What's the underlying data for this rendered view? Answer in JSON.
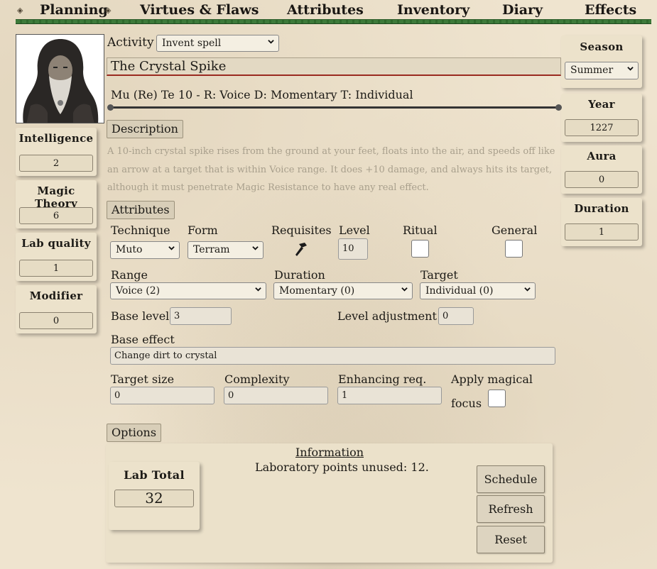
{
  "nav": {
    "items": [
      "Planning",
      "Virtues & Flaws",
      "Attributes",
      "Inventory",
      "Diary",
      "Effects"
    ]
  },
  "left_stats": [
    {
      "title": "Intelligence",
      "value": "2"
    },
    {
      "title": "Magic Theory",
      "value": "6"
    },
    {
      "title": "Lab quality",
      "value": "1"
    },
    {
      "title": "Modifier",
      "value": "0"
    }
  ],
  "right_stats": {
    "season": {
      "title": "Season",
      "value": "Summer"
    },
    "year": {
      "title": "Year",
      "value": "1227"
    },
    "aura": {
      "title": "Aura",
      "value": "0"
    },
    "duration": {
      "title": "Duration",
      "value": "1"
    }
  },
  "activity": {
    "label": "Activity",
    "value": "Invent spell"
  },
  "spell": {
    "name": "The Crystal Spike",
    "summary": "Mu (Re) Te 10 - R: Voice D: Momentary T: Individual"
  },
  "description": {
    "button": "Description",
    "text": "A 10-inch crystal spike rises from the ground at your feet, floats into the air, and speeds off like an arrow at a target that is within Voice range. It does +10 damage, and always hits its target, although it must penetrate Magic Resistance to have any real effect."
  },
  "attributes": {
    "button": "Attributes",
    "technique": {
      "label": "Technique",
      "value": "Muto"
    },
    "form": {
      "label": "Form",
      "value": "Terram"
    },
    "requisites": {
      "label": "Requisites"
    },
    "level": {
      "label": "Level",
      "value": "10"
    },
    "ritual": {
      "label": "Ritual"
    },
    "general": {
      "label": "General"
    },
    "range": {
      "label": "Range",
      "value": "Voice (2)"
    },
    "duration": {
      "label": "Duration",
      "value": "Momentary (0)"
    },
    "target": {
      "label": "Target",
      "value": "Individual (0)"
    },
    "base_level": {
      "label": "Base level",
      "value": "3"
    },
    "level_adjustment": {
      "label": "Level adjustment",
      "value": "0"
    },
    "base_effect": {
      "label": "Base effect",
      "value": "Change dirt to crystal"
    },
    "target_size": {
      "label": "Target size",
      "value": "0"
    },
    "complexity": {
      "label": "Complexity",
      "value": "0"
    },
    "enhancing_req": {
      "label": "Enhancing req.",
      "value": "1"
    },
    "apply_focus": {
      "label_line1": "Apply magical",
      "label_line2": "focus"
    }
  },
  "options": {
    "button": "Options",
    "lab_total": {
      "title": "Lab Total",
      "value": "32"
    },
    "info_title": "Information",
    "info_text": "Laboratory points unused: 12.",
    "buttons": {
      "schedule": "Schedule",
      "refresh": "Refresh",
      "reset": "Reset"
    }
  }
}
